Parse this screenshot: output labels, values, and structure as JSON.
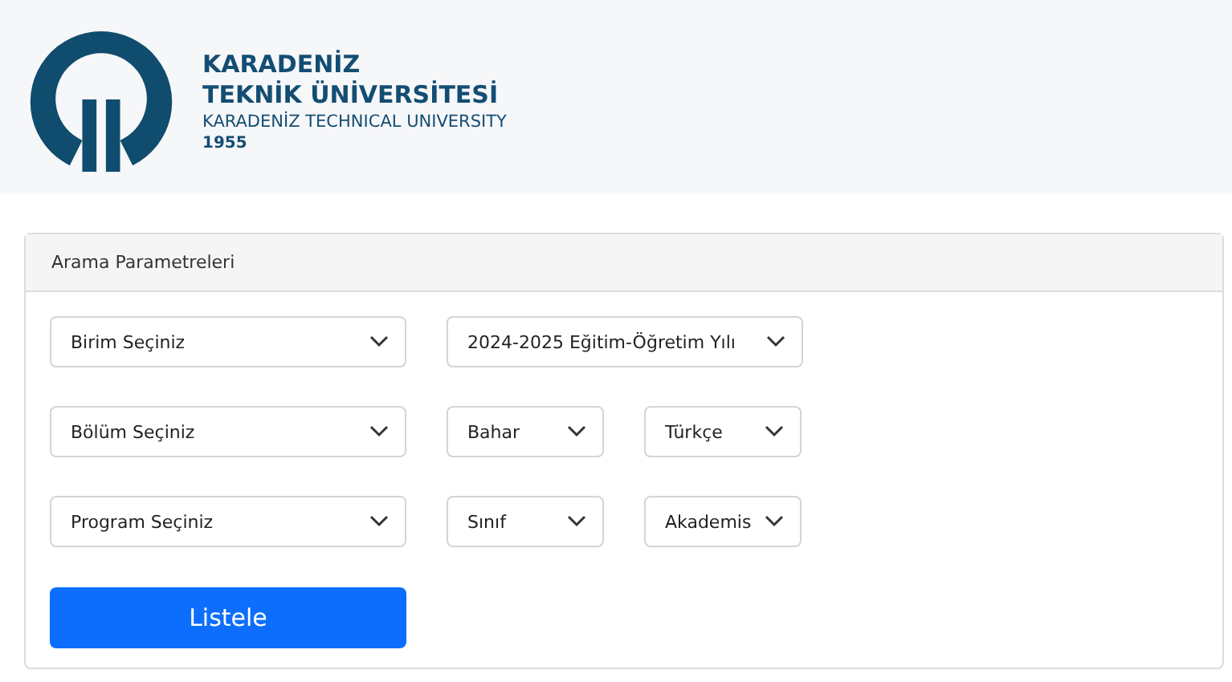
{
  "header": {
    "logo_lines": [
      "KARADENİZ",
      "TEKNİK ÜNİVERSİTESİ"
    ],
    "subtitle": "KARADENİZ TECHNICAL UNIVERSITY",
    "year": "1955"
  },
  "panel": {
    "title": "Arama Parametreleri",
    "rows": [
      [
        {
          "value": "Birim Seçiniz"
        },
        {
          "value": "2024-2025 Eğitim-Öğretim Yılı"
        }
      ],
      [
        {
          "value": "Bölüm Seçiniz"
        },
        {
          "value": "Bahar"
        },
        {
          "value": "Türkçe"
        }
      ],
      [
        {
          "value": "Program Seçiniz"
        },
        {
          "value": "Sınıf"
        },
        {
          "value": "Akademis"
        }
      ]
    ],
    "button": "Listele"
  }
}
